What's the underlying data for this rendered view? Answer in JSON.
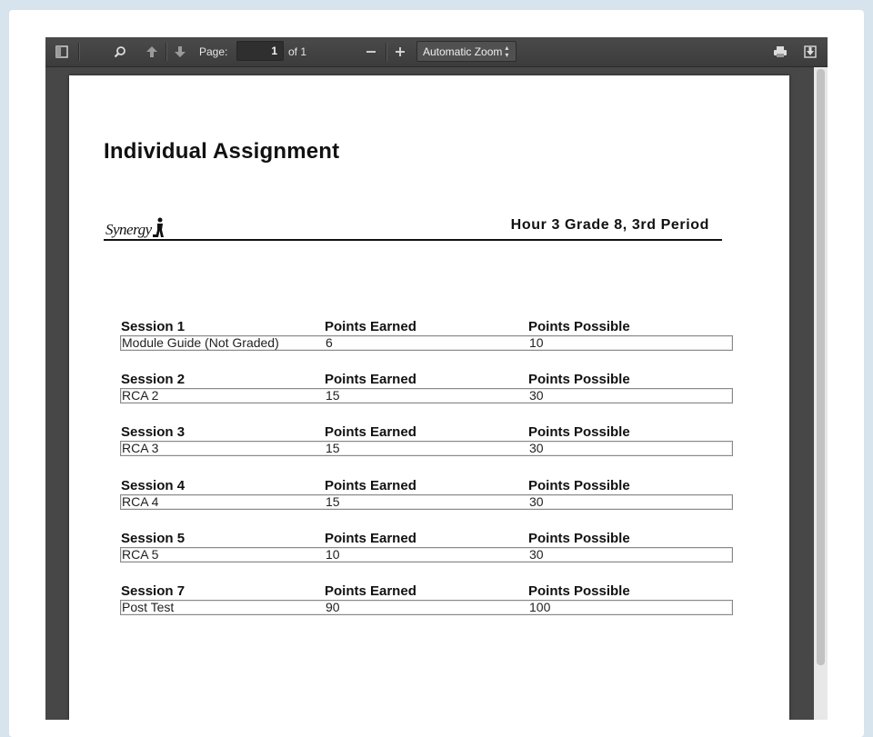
{
  "toolbar": {
    "page_label": "Page:",
    "page_value": "1",
    "page_total": "of 1",
    "zoom_value": "Automatic Zoom",
    "icons": {
      "sidebar_toggle": "sidebar-toggle-icon",
      "search": "search-icon",
      "previous_page": "arrow-up-icon",
      "next_page": "arrow-down-icon",
      "zoom_out": "minus-icon",
      "zoom_in": "plus-icon",
      "print": "printer-icon",
      "download": "download-icon"
    }
  },
  "document": {
    "title": "Individual Assignment",
    "logo_text": "Synergy",
    "class_info": "Hour 3 Grade 8, 3rd Period",
    "sessions": [
      {
        "name": "Session 1",
        "earned_header": "Points Earned",
        "possible_header": "Points Possible",
        "item": "Module Guide (Not Graded)",
        "earned": "6",
        "possible": "10"
      },
      {
        "name": "Session 2",
        "earned_header": "Points Earned",
        "possible_header": "Points Possible",
        "item": "RCA 2",
        "earned": "15",
        "possible": "30"
      },
      {
        "name": "Session 3",
        "earned_header": "Points Earned",
        "possible_header": "Points Possible",
        "item": "RCA 3",
        "earned": "15",
        "possible": "30"
      },
      {
        "name": "Session 4",
        "earned_header": "Points Earned",
        "possible_header": "Points Possible",
        "item": "RCA 4",
        "earned": "15",
        "possible": "30"
      },
      {
        "name": "Session 5",
        "earned_header": "Points Earned",
        "possible_header": "Points Possible",
        "item": "RCA 5",
        "earned": "10",
        "possible": "30"
      },
      {
        "name": "Session 7",
        "earned_header": "Points Earned",
        "possible_header": "Points Possible",
        "item": "Post Test",
        "earned": "90",
        "possible": "100"
      }
    ]
  }
}
